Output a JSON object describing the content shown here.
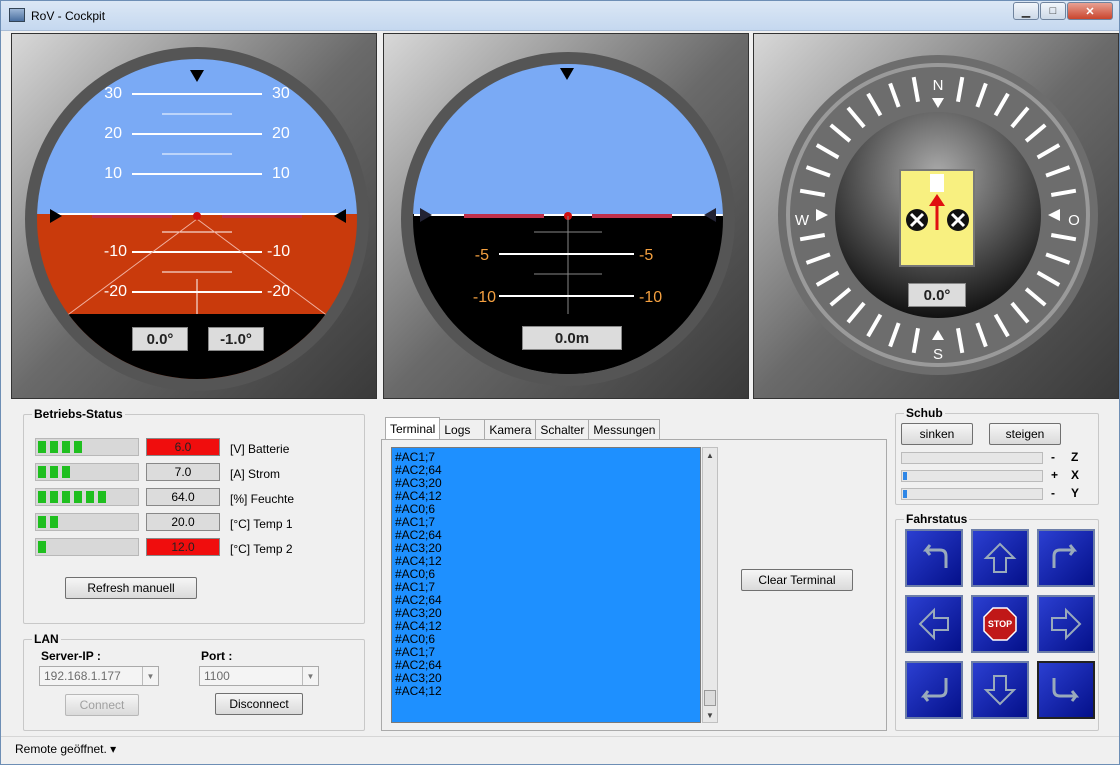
{
  "window": {
    "title": "RoV - Cockpit"
  },
  "instruments": {
    "attitude": {
      "scale": [
        "30",
        "20",
        "10",
        "-10",
        "-20"
      ],
      "roll": "0.0°",
      "pitch": "-1.0°"
    },
    "depth": {
      "scale": [
        "-5",
        "-10"
      ],
      "depth": "0.0m"
    },
    "compass": {
      "n": "N",
      "s": "S",
      "w": "W",
      "o": "O",
      "heading": "0.0°"
    }
  },
  "status": {
    "legend": "Betriebs-Status",
    "rows": [
      {
        "value": "6.0",
        "label": "[V] Batterie",
        "segments": 4,
        "alert": true
      },
      {
        "value": "7.0",
        "label": "[A] Strom",
        "segments": 3,
        "alert": false
      },
      {
        "value": "64.0",
        "label": "[%] Feuchte",
        "segments": 6,
        "alert": false
      },
      {
        "value": "20.0",
        "label": "[°C] Temp 1",
        "segments": 2,
        "alert": false
      },
      {
        "value": "12.0",
        "label": "[°C] Temp 2",
        "segments": 1,
        "alert": true
      }
    ],
    "refresh": "Refresh manuell"
  },
  "lan": {
    "legend": "LAN",
    "server_label": "Server-IP :",
    "server_value": "192.168.1.177",
    "port_label": "Port :",
    "port_value": "1100",
    "connect": "Connect",
    "disconnect": "Disconnect"
  },
  "tabs": [
    "Terminal",
    "Logs",
    "Kamera",
    "Schalter",
    "Messungen"
  ],
  "terminal": {
    "lines": [
      "#AC1;7",
      "#AC2;64",
      "#AC3;20",
      "#AC4;12",
      "#AC0;6",
      "#AC1;7",
      "#AC2;64",
      "#AC3;20",
      "#AC4;12",
      "#AC0;6",
      "#AC1;7",
      "#AC2;64",
      "#AC3;20",
      "#AC4;12",
      "#AC0;6",
      "#AC1;7",
      "#AC2;64",
      "#AC3;20",
      "#AC4;12"
    ],
    "clear": "Clear Terminal"
  },
  "schub": {
    "legend": "Schub",
    "sinken": "sinken",
    "steigen": "steigen",
    "axes": [
      {
        "sign": "-",
        "axis": "Z",
        "level": 0
      },
      {
        "sign": "+",
        "axis": "X",
        "level": 0.03
      },
      {
        "sign": "-",
        "axis": "Y",
        "level": 0.03
      }
    ]
  },
  "fahrstatus": {
    "legend": "Fahrstatus",
    "stop": "STOP"
  },
  "statusbar": {
    "text": "Remote geöffnet. ▾"
  }
}
